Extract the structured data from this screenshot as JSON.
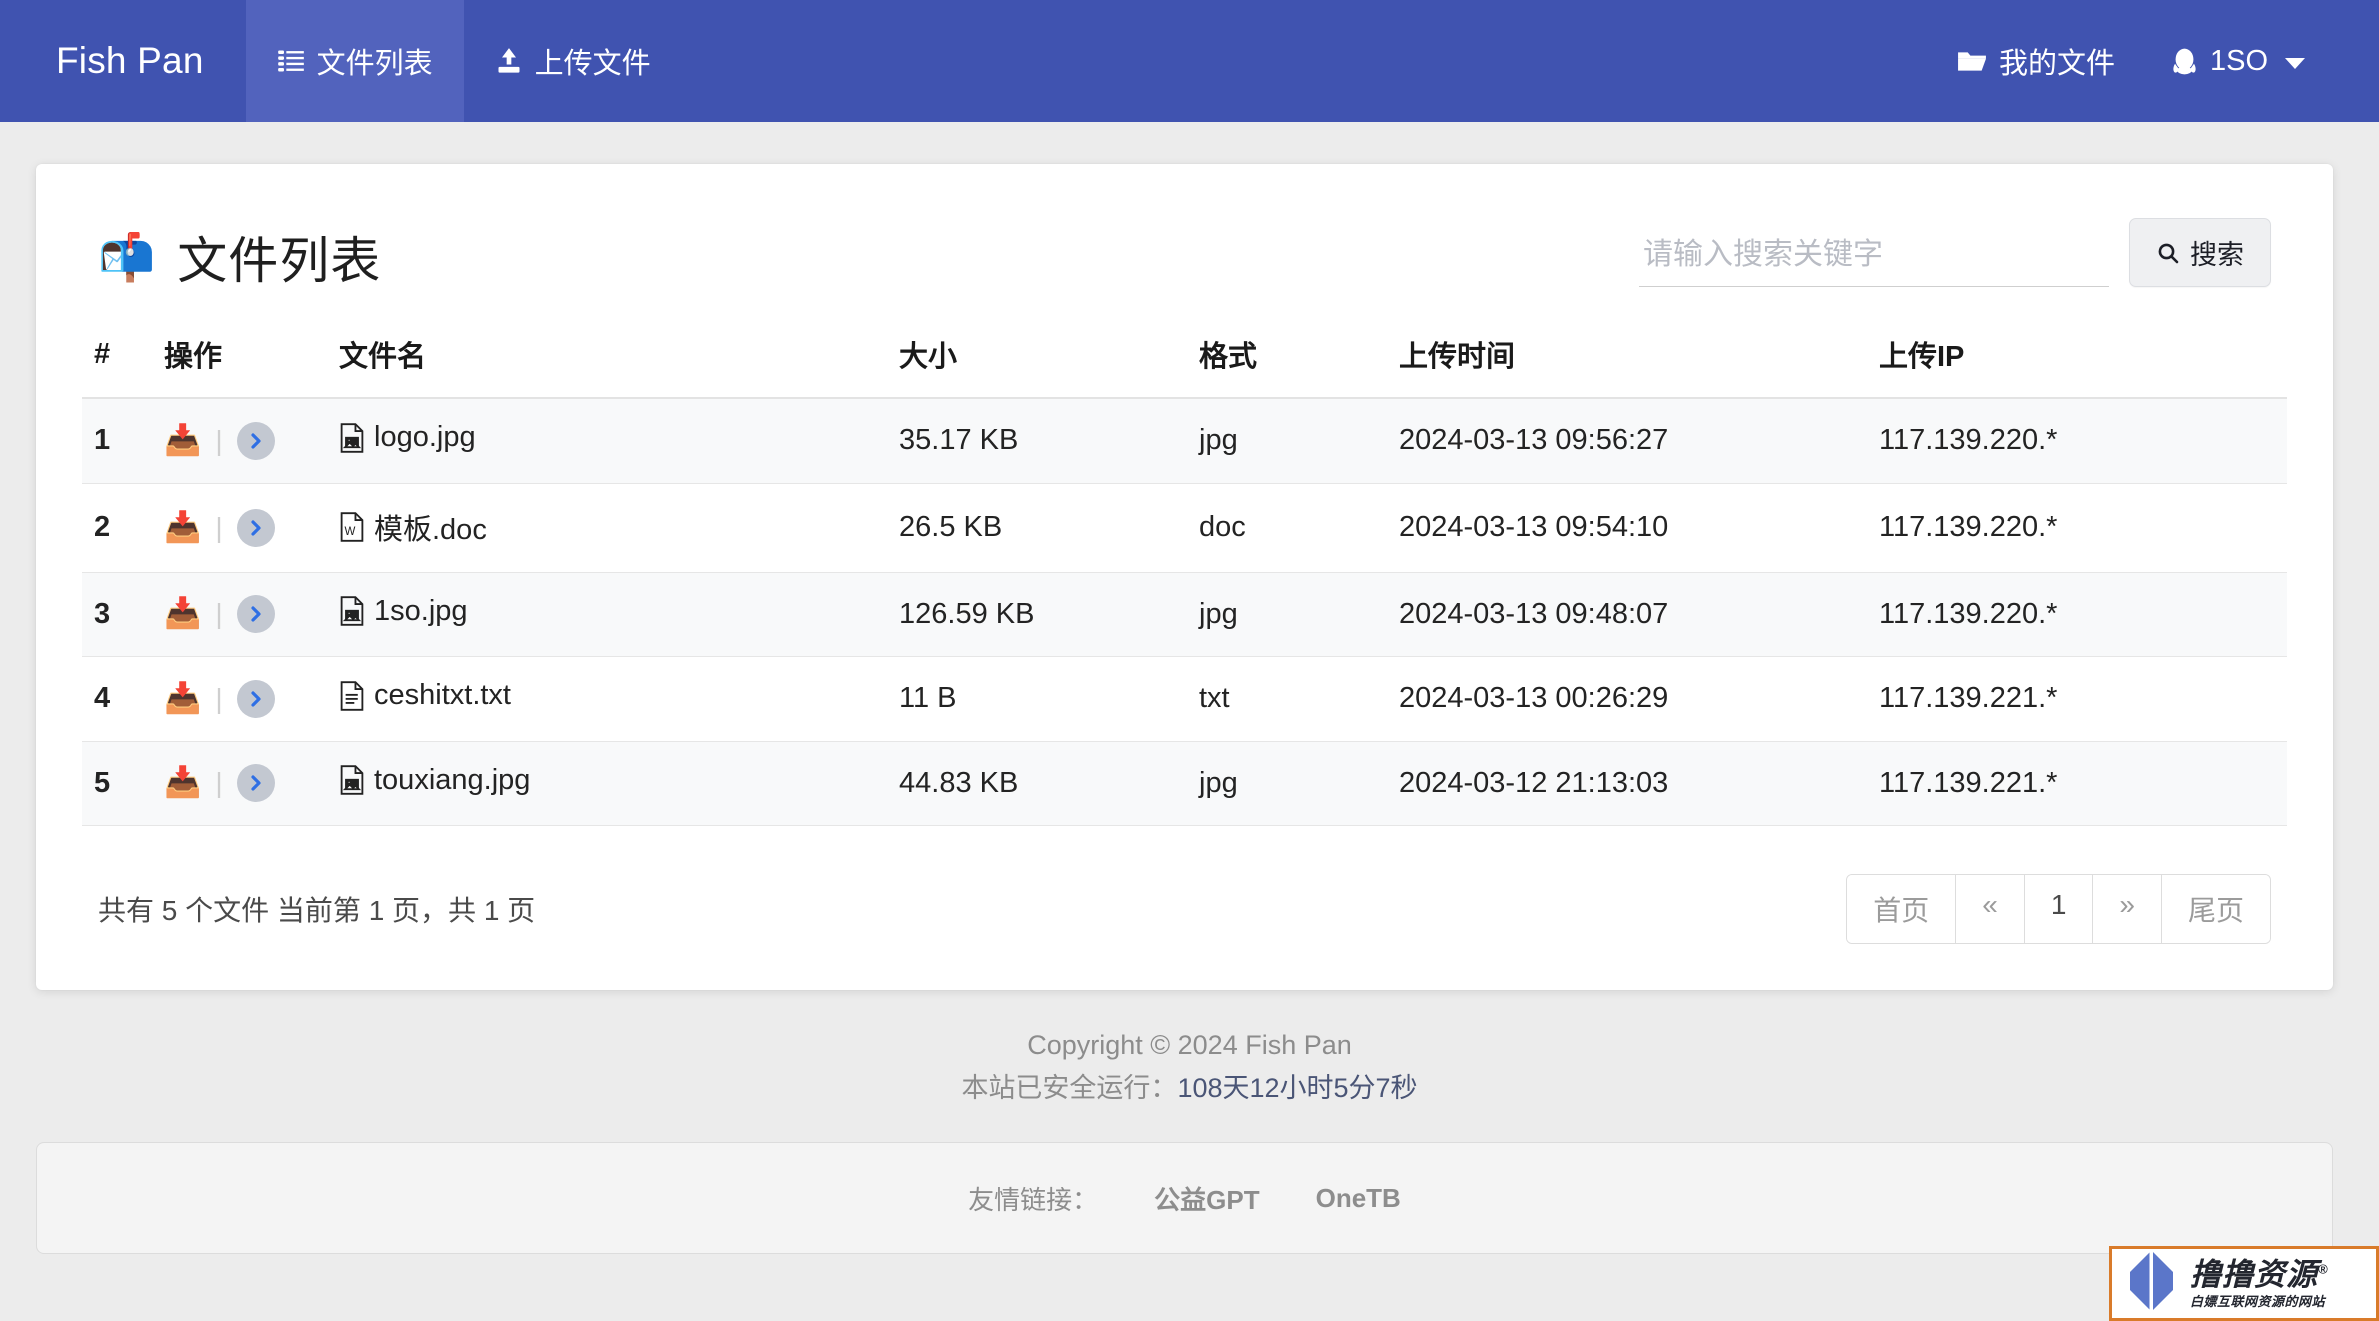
{
  "navbar": {
    "brand": "Fish Pan",
    "items": [
      {
        "label": "文件列表",
        "icon": "list-icon",
        "active": true
      },
      {
        "label": "上传文件",
        "icon": "upload-icon",
        "active": false
      }
    ],
    "right": [
      {
        "label": "我的文件",
        "icon": "folder-icon"
      },
      {
        "label": "1SO",
        "icon": "qq-penguin-icon",
        "caret": true
      }
    ],
    "bg_color": "#4053b0",
    "active_bg_color": "#5263bd"
  },
  "main": {
    "title": "文件列表",
    "title_emoji": "📬",
    "search": {
      "placeholder": "请输入搜索关键字",
      "value": "",
      "button_label": "搜索",
      "button_icon": "search-icon"
    },
    "table": {
      "headers": [
        "#",
        "操作",
        "文件名",
        "大小",
        "格式",
        "上传时间",
        "上传IP"
      ],
      "rows": [
        {
          "idx": "1",
          "name": "logo.jpg",
          "icon": "image-file-icon",
          "size": "35.17 KB",
          "format": "jpg",
          "time": "2024-03-13 09:56:27",
          "ip": "117.139.220.*"
        },
        {
          "idx": "2",
          "name": "模板.doc",
          "icon": "word-file-icon",
          "size": "26.5 KB",
          "format": "doc",
          "time": "2024-03-13 09:54:10",
          "ip": "117.139.220.*"
        },
        {
          "idx": "3",
          "name": "1so.jpg",
          "icon": "image-file-icon",
          "size": "126.59 KB",
          "format": "jpg",
          "time": "2024-03-13 09:48:07",
          "ip": "117.139.220.*"
        },
        {
          "idx": "4",
          "name": "ceshitxt.txt",
          "icon": "text-file-icon",
          "size": "11 B",
          "format": "txt",
          "time": "2024-03-13 00:26:29",
          "ip": "117.139.221.*"
        },
        {
          "idx": "5",
          "name": "touxiang.jpg",
          "icon": "image-file-icon",
          "size": "44.83 KB",
          "format": "jpg",
          "time": "2024-03-12 21:13:03",
          "ip": "117.139.221.*"
        }
      ],
      "row_actions": {
        "download_icon": "📥",
        "separator": "|",
        "detail_icon": "chevron-right-icon"
      }
    },
    "summary": "共有 5 个文件  当前第 1 页，共 1 页",
    "pagination": {
      "first": "首页",
      "prev": "«",
      "current": "1",
      "next": "»",
      "last": "尾页"
    }
  },
  "footer": {
    "copyright": "Copyright © 2024 Fish Pan",
    "uptime_label": "本站已安全运行：",
    "uptime_value": "108天12小时5分7秒",
    "links_label": "友情链接：",
    "links": [
      "公益GPT",
      "OneTB"
    ]
  },
  "watermark": {
    "main": "撸撸资源",
    "registered": "®",
    "sub": "白嫖互联网资源的网站",
    "border_color": "#d97b2a",
    "mark_color": "#5b76c9"
  }
}
